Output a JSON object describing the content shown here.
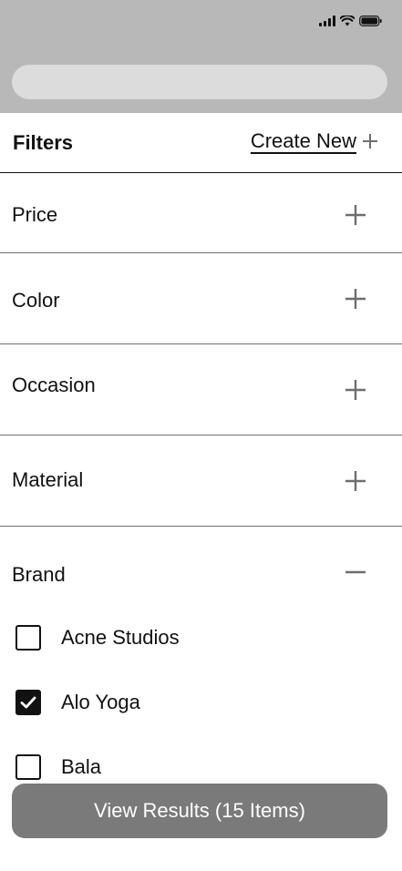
{
  "status_bar": {
    "icons": [
      "signal-icon",
      "wifi-icon",
      "battery-icon"
    ]
  },
  "search": {
    "value": "",
    "placeholder": ""
  },
  "filters": {
    "title": "Filters",
    "create_new_label": "Create New",
    "create_new_icon": "plus-icon"
  },
  "sections": {
    "price": {
      "label": "Price",
      "state": "collapsed",
      "icon": "plus-icon"
    },
    "color": {
      "label": "Color",
      "state": "collapsed",
      "icon": "plus-icon"
    },
    "occasion": {
      "label": "Occasion",
      "state": "collapsed",
      "icon": "plus-icon"
    },
    "material": {
      "label": "Material",
      "state": "collapsed",
      "icon": "plus-icon"
    },
    "brand": {
      "label": "Brand",
      "state": "expanded",
      "icon": "minus-icon",
      "options": [
        {
          "label": "Acne Studios",
          "checked": false
        },
        {
          "label": "Alo Yoga",
          "checked": true
        },
        {
          "label": "Bala",
          "checked": false
        }
      ]
    }
  },
  "results_button": {
    "label": "View Results (15 Items)"
  },
  "colors": {
    "header_gray": "#b8b8b8",
    "search_fill": "#dcdcdc",
    "button_fill": "#7a7a7a",
    "icon_gray": "#6e6e6e",
    "text": "#111111"
  }
}
